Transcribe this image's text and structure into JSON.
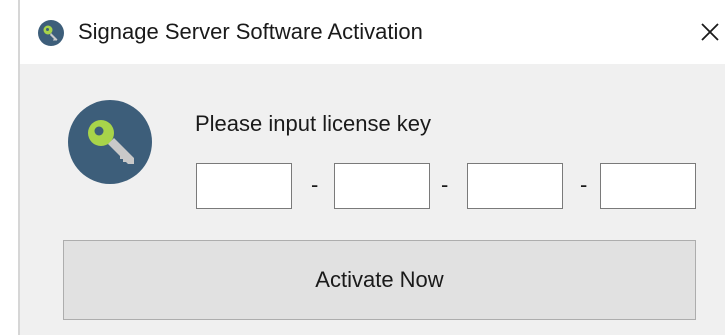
{
  "window": {
    "title": "Signage Server Software Activation",
    "app_icon": "key-icon",
    "close_icon": "close-icon"
  },
  "form": {
    "prompt": "Please input license key",
    "key_icon": "key-icon",
    "fields": [
      {
        "value": "",
        "placeholder": ""
      },
      {
        "value": "",
        "placeholder": ""
      },
      {
        "value": "",
        "placeholder": ""
      },
      {
        "value": "",
        "placeholder": ""
      }
    ],
    "separator": "-",
    "activate_label": "Activate Now"
  },
  "colors": {
    "icon_circle": "#3d5e7a",
    "key_green": "#a8d44a",
    "client_background": "#f0f0f0",
    "button_face": "#e1e1e1"
  }
}
